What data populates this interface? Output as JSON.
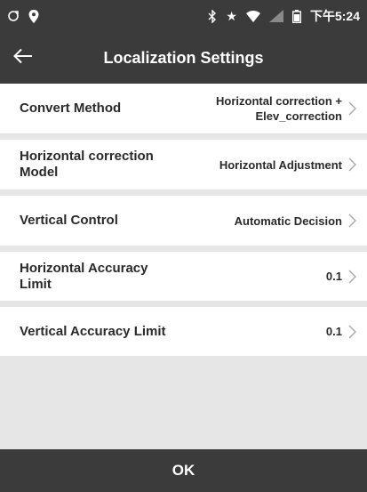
{
  "status_bar": {
    "time": "下午5:24",
    "left_icons": [
      "sync-icon",
      "location-pin-icon"
    ],
    "right_icons": [
      "bluetooth-icon",
      "star-icon",
      "wifi-icon",
      "signal-icon",
      "battery-icon"
    ]
  },
  "app_bar": {
    "title": "Localization Settings",
    "back_icon": "arrow-left-icon"
  },
  "settings": [
    {
      "label": "Convert Method",
      "value": "Horizontal correction + Elev_correction"
    },
    {
      "label": "Horizontal correction Model",
      "value": "Horizontal Adjustment"
    },
    {
      "label": "Vertical Control",
      "value": "Automatic Decision"
    },
    {
      "label": "Horizontal Accuracy Limit",
      "value": "0.1"
    },
    {
      "label": "Vertical Accuracy Limit",
      "value": "0.1"
    }
  ],
  "footer": {
    "ok_label": "OK"
  },
  "colors": {
    "bar": "#3b3b3b",
    "background": "#e6e6e6",
    "row": "#ffffff",
    "text": "#2a2a2a"
  }
}
